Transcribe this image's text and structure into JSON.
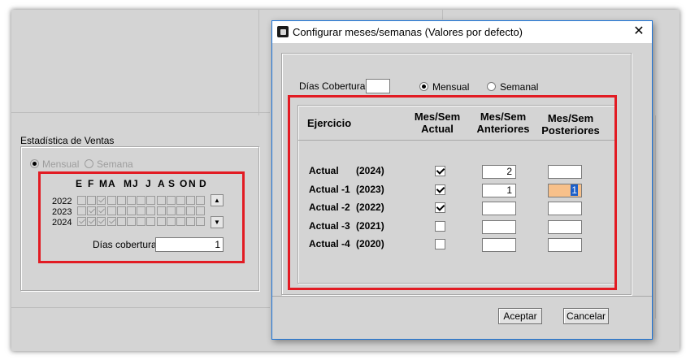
{
  "background": {
    "group_title": "Estadística de Ventas",
    "radio_monthly": "Mensual",
    "radio_weekly": "Semana",
    "month_letters": [
      "E",
      "F",
      "M",
      "A",
      "M",
      "J",
      "J",
      "A",
      "S",
      "O",
      "N",
      "D"
    ],
    "years": [
      "2022",
      "2023",
      "2024"
    ],
    "dias_label": "Días cobertura",
    "dias_value": "1"
  },
  "dialog": {
    "title": "Configurar meses/semanas (Valores por defecto)",
    "close_glyph": "✕",
    "dias_label": "Días Cobertura",
    "dias_value": "",
    "radio_monthly": "Mensual",
    "radio_weekly": "Semanal",
    "headers": {
      "ejercicio": "Ejercicio",
      "actual_l1": "Mes/Sem",
      "actual_l2": "Actual",
      "anteriores_l1": "Mes/Sem",
      "anteriores_l2": "Anteriores",
      "posteriores_l1": "Mes/Sem",
      "posteriores_l2": "Posteriores"
    },
    "rows": [
      {
        "label": "Actual",
        "year": "(2024)",
        "checked": true,
        "anteriores": "2",
        "posteriores": ""
      },
      {
        "label": "Actual -1",
        "year": "(2023)",
        "checked": true,
        "anteriores": "1",
        "posteriores": "1"
      },
      {
        "label": "Actual -2",
        "year": "(2022)",
        "checked": true,
        "anteriores": "",
        "posteriores": ""
      },
      {
        "label": "Actual -3",
        "year": "(2021)",
        "checked": false,
        "anteriores": "",
        "posteriores": ""
      },
      {
        "label": "Actual -4",
        "year": "(2020)",
        "checked": false,
        "anteriores": "",
        "posteriores": ""
      }
    ],
    "accept_label": "Aceptar",
    "cancel_label": "Cancelar"
  },
  "colors": {
    "highlight_red": "#e21b23",
    "focus_field": "#f7c08a",
    "title_border": "#1a73d8"
  }
}
